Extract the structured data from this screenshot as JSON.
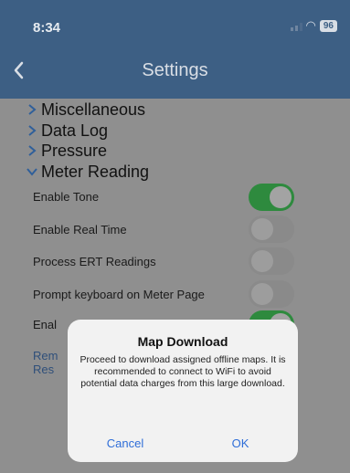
{
  "status_bar": {
    "time": "8:34",
    "battery": "96"
  },
  "header": {
    "title": "Settings"
  },
  "sections": [
    {
      "label": "Miscellaneous",
      "expanded": false
    },
    {
      "label": "Data Log",
      "expanded": false
    },
    {
      "label": "Pressure",
      "expanded": false
    },
    {
      "label": "Meter Reading",
      "expanded": true
    }
  ],
  "rows": [
    {
      "label": "Enable Tone",
      "toggle": true
    },
    {
      "label": "Enable Real Time",
      "toggle": false
    },
    {
      "label": "Process ERT Readings",
      "toggle": false
    },
    {
      "label": "Prompt keyboard on Meter Page",
      "toggle": false
    },
    {
      "label": "Enal",
      "toggle": true
    }
  ],
  "partial_links": [
    "Rem",
    "Res"
  ],
  "alert": {
    "title": "Map Download",
    "message": "Proceed to download assigned offline maps. It is recommended to connect to WiFi to avoid potential data charges from this large download.",
    "cancel_label": "Cancel",
    "ok_label": "OK"
  },
  "colors": {
    "header_bg": "#3d5f84",
    "toggle_on": "#2e8a3e",
    "link": "#2f6ed8"
  }
}
